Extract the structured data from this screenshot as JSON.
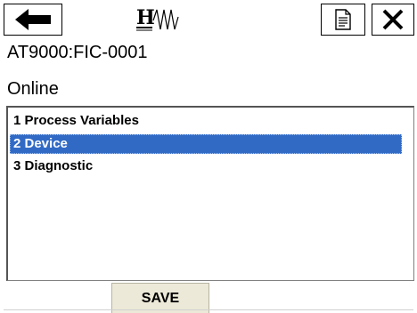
{
  "toolbar": {
    "back_icon": "left-arrow-icon",
    "logo_icon": "hart-logo-icon",
    "document_icon": "document-icon",
    "close_icon": "close-x-icon"
  },
  "device_tag": "AT9000:FIC-0001",
  "status": "Online",
  "menu": {
    "items": [
      {
        "label": "1 Process Variables",
        "selected": false
      },
      {
        "label": "2 Device",
        "selected": true
      },
      {
        "label": "3 Diagnostic",
        "selected": false
      }
    ],
    "selected_bg": "#316ac5"
  },
  "bottom": {
    "save_label": "SAVE"
  }
}
